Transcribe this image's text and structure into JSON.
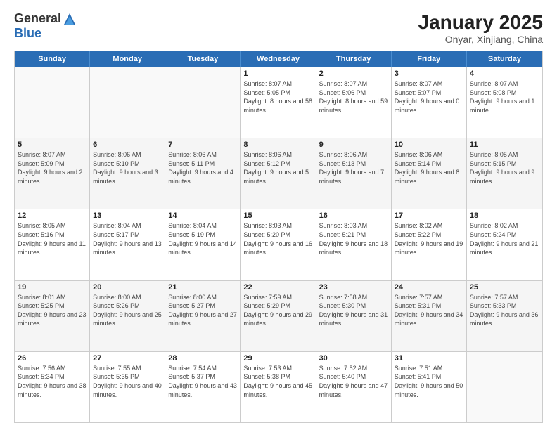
{
  "header": {
    "logo_general": "General",
    "logo_blue": "Blue",
    "title": "January 2025",
    "subtitle": "Onyar, Xinjiang, China"
  },
  "days_of_week": [
    "Sunday",
    "Monday",
    "Tuesday",
    "Wednesday",
    "Thursday",
    "Friday",
    "Saturday"
  ],
  "weeks": [
    [
      {
        "day": "",
        "empty": true
      },
      {
        "day": "",
        "empty": true
      },
      {
        "day": "",
        "empty": true
      },
      {
        "day": "1",
        "sunrise": "8:07 AM",
        "sunset": "5:05 PM",
        "daylight": "8 hours and 58 minutes."
      },
      {
        "day": "2",
        "sunrise": "8:07 AM",
        "sunset": "5:06 PM",
        "daylight": "8 hours and 59 minutes."
      },
      {
        "day": "3",
        "sunrise": "8:07 AM",
        "sunset": "5:07 PM",
        "daylight": "9 hours and 0 minutes."
      },
      {
        "day": "4",
        "sunrise": "8:07 AM",
        "sunset": "5:08 PM",
        "daylight": "9 hours and 1 minute."
      }
    ],
    [
      {
        "day": "5",
        "sunrise": "8:07 AM",
        "sunset": "5:09 PM",
        "daylight": "9 hours and 2 minutes."
      },
      {
        "day": "6",
        "sunrise": "8:06 AM",
        "sunset": "5:10 PM",
        "daylight": "9 hours and 3 minutes."
      },
      {
        "day": "7",
        "sunrise": "8:06 AM",
        "sunset": "5:11 PM",
        "daylight": "9 hours and 4 minutes."
      },
      {
        "day": "8",
        "sunrise": "8:06 AM",
        "sunset": "5:12 PM",
        "daylight": "9 hours and 5 minutes."
      },
      {
        "day": "9",
        "sunrise": "8:06 AM",
        "sunset": "5:13 PM",
        "daylight": "9 hours and 7 minutes."
      },
      {
        "day": "10",
        "sunrise": "8:06 AM",
        "sunset": "5:14 PM",
        "daylight": "9 hours and 8 minutes."
      },
      {
        "day": "11",
        "sunrise": "8:05 AM",
        "sunset": "5:15 PM",
        "daylight": "9 hours and 9 minutes."
      }
    ],
    [
      {
        "day": "12",
        "sunrise": "8:05 AM",
        "sunset": "5:16 PM",
        "daylight": "9 hours and 11 minutes."
      },
      {
        "day": "13",
        "sunrise": "8:04 AM",
        "sunset": "5:17 PM",
        "daylight": "9 hours and 13 minutes."
      },
      {
        "day": "14",
        "sunrise": "8:04 AM",
        "sunset": "5:19 PM",
        "daylight": "9 hours and 14 minutes."
      },
      {
        "day": "15",
        "sunrise": "8:03 AM",
        "sunset": "5:20 PM",
        "daylight": "9 hours and 16 minutes."
      },
      {
        "day": "16",
        "sunrise": "8:03 AM",
        "sunset": "5:21 PM",
        "daylight": "9 hours and 18 minutes."
      },
      {
        "day": "17",
        "sunrise": "8:02 AM",
        "sunset": "5:22 PM",
        "daylight": "9 hours and 19 minutes."
      },
      {
        "day": "18",
        "sunrise": "8:02 AM",
        "sunset": "5:24 PM",
        "daylight": "9 hours and 21 minutes."
      }
    ],
    [
      {
        "day": "19",
        "sunrise": "8:01 AM",
        "sunset": "5:25 PM",
        "daylight": "9 hours and 23 minutes."
      },
      {
        "day": "20",
        "sunrise": "8:00 AM",
        "sunset": "5:26 PM",
        "daylight": "9 hours and 25 minutes."
      },
      {
        "day": "21",
        "sunrise": "8:00 AM",
        "sunset": "5:27 PM",
        "daylight": "9 hours and 27 minutes."
      },
      {
        "day": "22",
        "sunrise": "7:59 AM",
        "sunset": "5:29 PM",
        "daylight": "9 hours and 29 minutes."
      },
      {
        "day": "23",
        "sunrise": "7:58 AM",
        "sunset": "5:30 PM",
        "daylight": "9 hours and 31 minutes."
      },
      {
        "day": "24",
        "sunrise": "7:57 AM",
        "sunset": "5:31 PM",
        "daylight": "9 hours and 34 minutes."
      },
      {
        "day": "25",
        "sunrise": "7:57 AM",
        "sunset": "5:33 PM",
        "daylight": "9 hours and 36 minutes."
      }
    ],
    [
      {
        "day": "26",
        "sunrise": "7:56 AM",
        "sunset": "5:34 PM",
        "daylight": "9 hours and 38 minutes."
      },
      {
        "day": "27",
        "sunrise": "7:55 AM",
        "sunset": "5:35 PM",
        "daylight": "9 hours and 40 minutes."
      },
      {
        "day": "28",
        "sunrise": "7:54 AM",
        "sunset": "5:37 PM",
        "daylight": "9 hours and 43 minutes."
      },
      {
        "day": "29",
        "sunrise": "7:53 AM",
        "sunset": "5:38 PM",
        "daylight": "9 hours and 45 minutes."
      },
      {
        "day": "30",
        "sunrise": "7:52 AM",
        "sunset": "5:40 PM",
        "daylight": "9 hours and 47 minutes."
      },
      {
        "day": "31",
        "sunrise": "7:51 AM",
        "sunset": "5:41 PM",
        "daylight": "9 hours and 50 minutes."
      },
      {
        "day": "",
        "empty": true
      }
    ]
  ]
}
